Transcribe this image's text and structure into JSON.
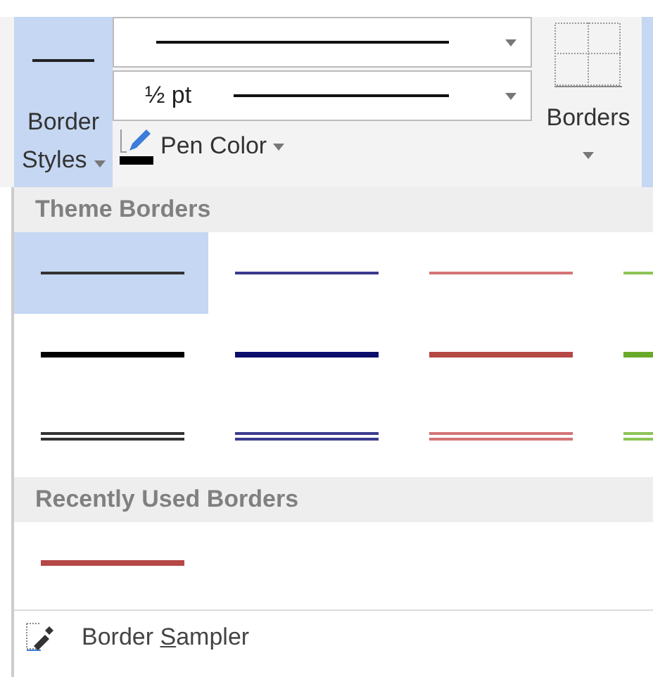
{
  "ribbon": {
    "border_styles": {
      "label": "Border Styles",
      "expanded": true
    },
    "style_dropdown": {
      "kind": "solid"
    },
    "weight_dropdown": {
      "value": "½ pt"
    },
    "pen_color": {
      "label": "Pen Color",
      "color": "#000000"
    },
    "borders_button": {
      "label": "Borders"
    }
  },
  "gallery": {
    "sections": [
      {
        "title": "Theme Borders",
        "items": [
          {
            "kind": "thin",
            "color": "#333333",
            "selected": true
          },
          {
            "kind": "thin",
            "color": "#3b3b8f",
            "selected": false
          },
          {
            "kind": "thin",
            "color": "#d47575",
            "selected": false
          },
          {
            "kind": "thin",
            "color": "#8dc456",
            "selected": false
          },
          {
            "kind": "thick",
            "color": "#000000",
            "selected": false
          },
          {
            "kind": "thick",
            "color": "#0d0d6b",
            "selected": false
          },
          {
            "kind": "thick",
            "color": "#b54745",
            "selected": false
          },
          {
            "kind": "thick",
            "color": "#6aaa2a",
            "selected": false
          },
          {
            "kind": "double",
            "color": "#333333",
            "selected": false
          },
          {
            "kind": "double",
            "color": "#3b3b8f",
            "selected": false
          },
          {
            "kind": "double",
            "color": "#d47575",
            "selected": false
          },
          {
            "kind": "double",
            "color": "#8dc456",
            "selected": false
          }
        ]
      },
      {
        "title": "Recently Used Borders",
        "items": [
          {
            "kind": "thick",
            "color": "#b54745",
            "selected": false
          }
        ]
      }
    ],
    "sampler": {
      "label_start": "Border ",
      "access_key": "S",
      "label_end": "ampler"
    }
  }
}
